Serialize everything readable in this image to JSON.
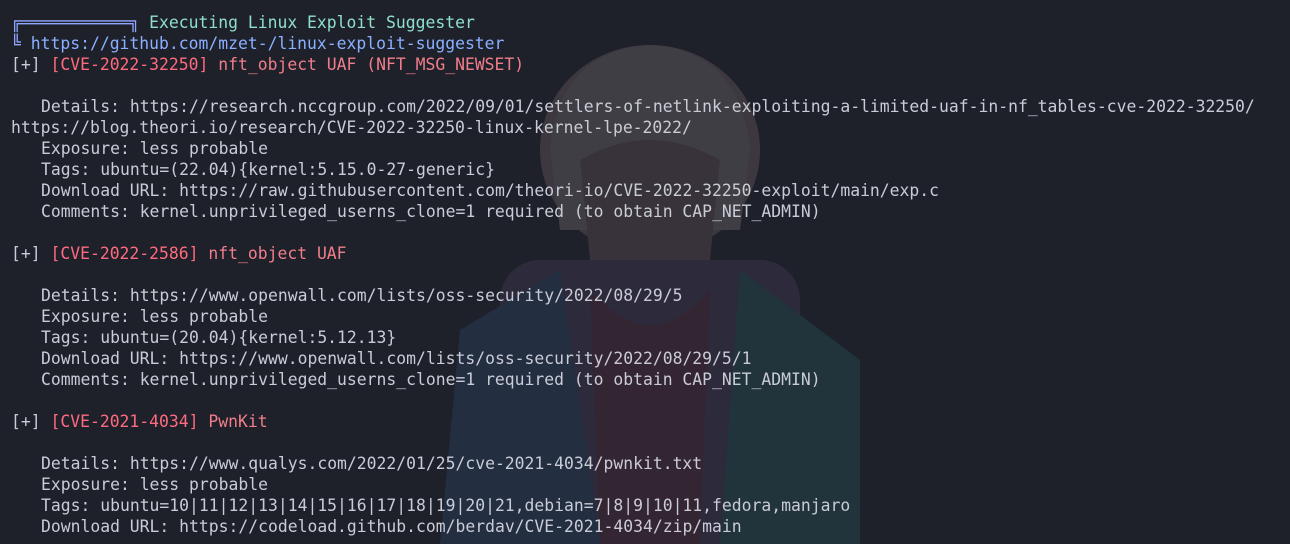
{
  "header": {
    "box_top": "╔═══════════╗",
    "title": "Executing Linux Exploit Suggester",
    "box_bottom": "╚",
    "url": "https://github.com/mzet-/linux-exploit-suggester"
  },
  "entries": [
    {
      "marker": "[+]",
      "cve": "[CVE-2022-32250]",
      "name": "nft_object UAF (NFT_MSG_NEWSET)",
      "details_label": "Details:",
      "details_value": "https://research.nccgroup.com/2022/09/01/settlers-of-netlink-exploiting-a-limited-uaf-in-nf_tables-cve-2022-32250/",
      "details_wrap": "https://blog.theori.io/research/CVE-2022-32250-linux-kernel-lpe-2022/",
      "exposure_label": "Exposure:",
      "exposure_value": "less probable",
      "tags_label": "Tags:",
      "tags_value": "ubuntu=(22.04){kernel:5.15.0-27-generic}",
      "download_label": "Download URL:",
      "download_value": "https://raw.githubusercontent.com/theori-io/CVE-2022-32250-exploit/main/exp.c",
      "comments_label": "Comments:",
      "comments_value": "kernel.unprivileged_userns_clone=1 required (to obtain CAP_NET_ADMIN)"
    },
    {
      "marker": "[+]",
      "cve": "[CVE-2022-2586]",
      "name": "nft_object UAF",
      "details_label": "Details:",
      "details_value": "https://www.openwall.com/lists/oss-security/2022/08/29/5",
      "exposure_label": "Exposure:",
      "exposure_value": "less probable",
      "tags_label": "Tags:",
      "tags_value": "ubuntu=(20.04){kernel:5.12.13}",
      "download_label": "Download URL:",
      "download_value": "https://www.openwall.com/lists/oss-security/2022/08/29/5/1",
      "comments_label": "Comments:",
      "comments_value": "kernel.unprivileged_userns_clone=1 required (to obtain CAP_NET_ADMIN)"
    },
    {
      "marker": "[+]",
      "cve": "[CVE-2021-4034]",
      "name": "PwnKit",
      "details_label": "Details:",
      "details_value": "https://www.qualys.com/2022/01/25/cve-2021-4034/pwnkit.txt",
      "exposure_label": "Exposure:",
      "exposure_value": "less probable",
      "tags_label": "Tags:",
      "tags_value": "ubuntu=10|11|12|13|14|15|16|17|18|19|20|21,debian=7|8|9|10|11,fedora,manjaro",
      "download_label": "Download URL:",
      "download_value": "https://codeload.github.com/berdav/CVE-2021-4034/zip/main"
    }
  ],
  "colors": {
    "background": "#1e202a",
    "text": "#c9ccd6",
    "cve": "#ff6b7e",
    "header_text": "#8ee0c8",
    "url": "#8ab0ff",
    "box": "#8fa6ff"
  }
}
